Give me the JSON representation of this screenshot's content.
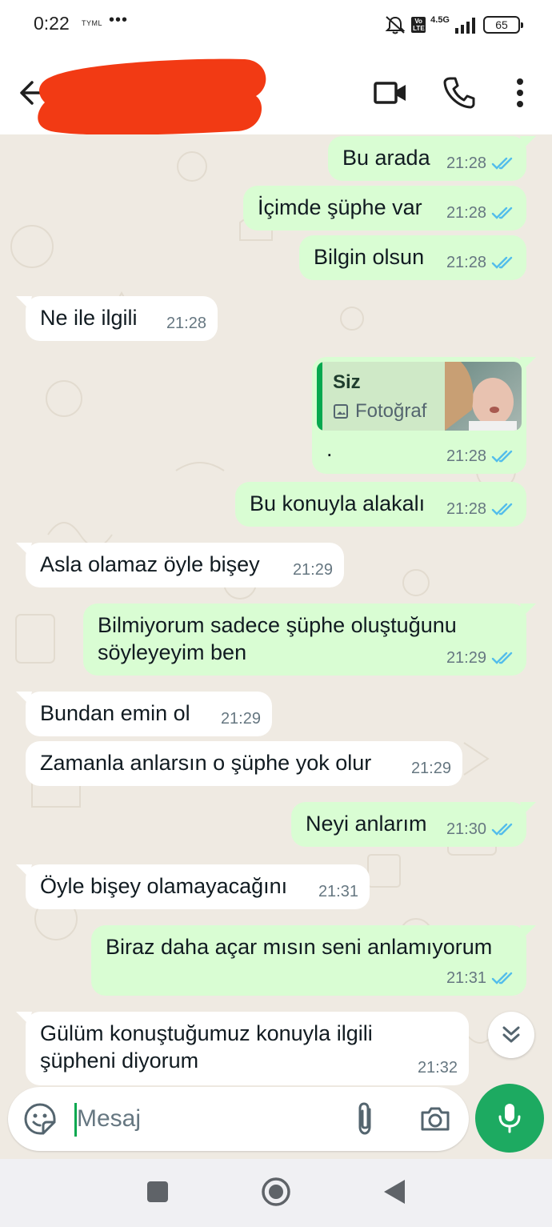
{
  "status_bar": {
    "time": "0:22",
    "carrier": "TYML",
    "more": "•••",
    "volte": "Vo LTE",
    "network": "4.5G",
    "battery": "65"
  },
  "header": {
    "contact_name_redacted": true,
    "icons": [
      "back-arrow-icon",
      "video-call-icon",
      "phone-call-icon",
      "more-vertical-icon"
    ]
  },
  "colors": {
    "outgoing_bubble": "#d9fdd3",
    "incoming_bubble": "#ffffff",
    "chat_background": "#efeae2",
    "read_ticks": "#53bdeb",
    "accent_green": "#1daa61",
    "redaction": "#f23a14"
  },
  "messages": [
    {
      "dir": "out",
      "text": "Bu arada",
      "time": "21:28",
      "read": true
    },
    {
      "dir": "out",
      "text": "İçimde şüphe var",
      "time": "21:28",
      "read": true
    },
    {
      "dir": "out",
      "text": "Bilgin olsun",
      "time": "21:28",
      "read": true
    },
    {
      "dir": "in",
      "text": "Ne ile ilgili",
      "time": "21:28"
    },
    {
      "dir": "out",
      "text": ".",
      "time": "21:28",
      "read": true,
      "quote": {
        "author": "Siz",
        "type": "Fotoğraf"
      }
    },
    {
      "dir": "out",
      "text": "Bu konuyla alakalı",
      "time": "21:28",
      "read": true
    },
    {
      "dir": "in",
      "text": "Asla olamaz öyle bişey",
      "time": "21:29"
    },
    {
      "dir": "out",
      "text": "Bilmiyorum sadece şüphe oluştuğunu",
      "text2": "söyleyeyim ben",
      "time": "21:29",
      "read": true
    },
    {
      "dir": "in",
      "text": "Bundan emin ol",
      "time": "21:29"
    },
    {
      "dir": "in",
      "text": "Zamanla anlarsın o şüphe yok olur",
      "time": "21:29"
    },
    {
      "dir": "out",
      "text": "Neyi anlarım",
      "time": "21:30",
      "read": true
    },
    {
      "dir": "in",
      "text": "Öyle bişey olamayacağını",
      "time": "21:31"
    },
    {
      "dir": "out",
      "text": "Biraz daha açar mısın seni anlamıyorum",
      "time": "21:31",
      "read": true
    },
    {
      "dir": "in",
      "text": "Gülüm konuştuğumuz konuyla ilgili",
      "text2": "şüpheni diyorum",
      "time": "21:32"
    }
  ],
  "composer": {
    "placeholder": "Mesaj"
  }
}
